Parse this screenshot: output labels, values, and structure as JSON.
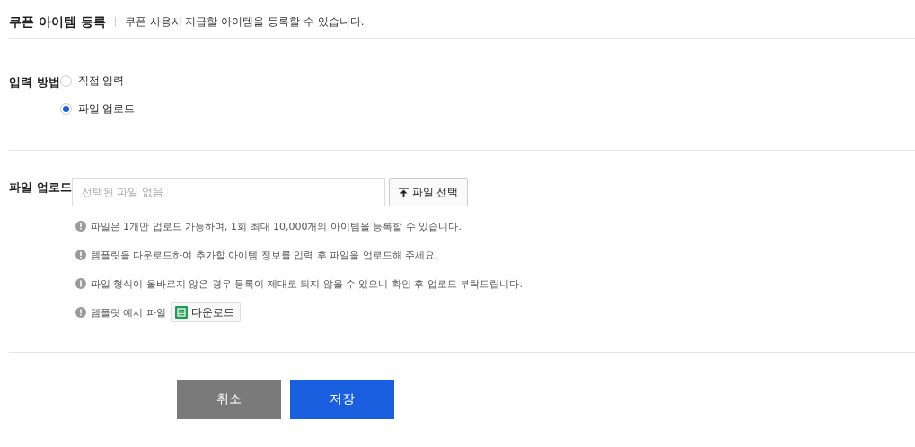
{
  "header": {
    "title": "쿠폰 아이템 등록",
    "description": "쿠폰 사용시 지급할 아이템을 등록할 수 있습니다."
  },
  "input_method": {
    "label": "입력 방법",
    "options": [
      {
        "label": "직접 입력",
        "selected": false
      },
      {
        "label": "파일 업로드",
        "selected": true
      }
    ]
  },
  "file_upload": {
    "label": "파일 업로드",
    "field": {
      "placeholder": "선택된 파일 없음"
    },
    "select_button": "파일 선택",
    "notes": [
      {
        "text": "파일은 1개만 업로드 가능하며, 1회 최대 10,000개의 아이템을 등록할 수 있습니다."
      },
      {
        "text": "템플릿을 다운로드하여 추가할 아이템 정보를 입력 후 파일을 업로드해 주세요."
      },
      {
        "text": "파일 형식이 올바르지 않은 경우 등록이 제대로 되지 않을 수 있으니 확인 후 업로드 부탁드립니다."
      },
      {
        "text": "템플릿 예시 파일",
        "download_button": "다운로드"
      }
    ]
  },
  "buttons": {
    "cancel": "취소",
    "save": "저장"
  }
}
